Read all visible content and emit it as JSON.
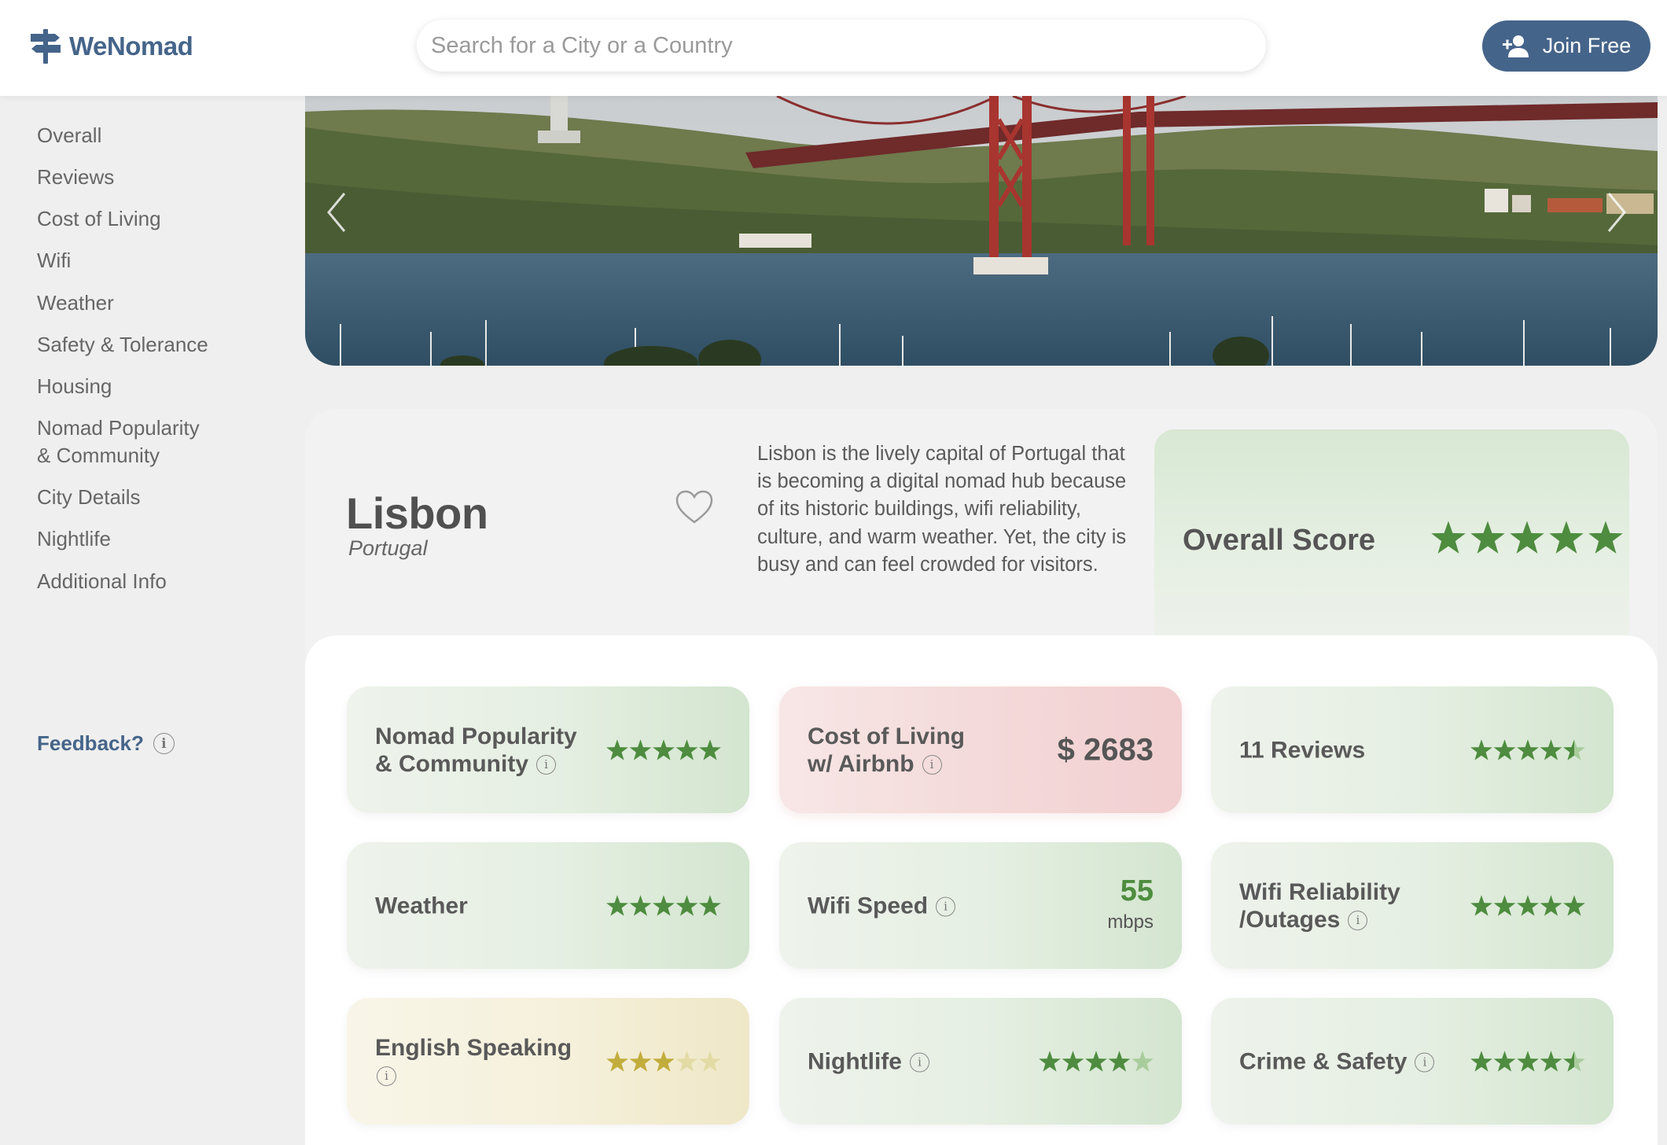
{
  "brand": {
    "name": "WeNomad",
    "color": "#45648a"
  },
  "header": {
    "search_placeholder": "Search for a City or a Country",
    "join_label": "Join Free"
  },
  "sidebar": {
    "items": [
      {
        "label": "Overall"
      },
      {
        "label": "Reviews"
      },
      {
        "label": "Cost of Living"
      },
      {
        "label": "Wifi"
      },
      {
        "label": "Weather"
      },
      {
        "label": "Safety & Tolerance"
      },
      {
        "label": "Housing"
      },
      {
        "label": "Nomad Popularity",
        "label2": "& Community"
      },
      {
        "label": "City Details"
      },
      {
        "label": "Nightlife"
      },
      {
        "label": "Additional Info"
      }
    ],
    "feedback_label": "Feedback?"
  },
  "city": {
    "name": "Lisbon",
    "country": "Portugal",
    "description": "Lisbon is the lively capital of Portugal that is becoming a digital nomad hub because of its historic buildings, wifi reliability, culture, and warm weather. Yet, the city is busy and can feel crowded for visitors."
  },
  "overall": {
    "label": "Overall Score",
    "rating": 5
  },
  "colors": {
    "star_green": "#4e8c3f",
    "star_green_light": "#a9cc9c",
    "star_yellow": "#c2ad3c",
    "star_yellow_light": "#e3dba5"
  },
  "tiles": [
    {
      "line1": "Nomad Popularity",
      "line2": "& Community",
      "rating": 5,
      "color": "green"
    },
    {
      "line1": "Cost of Living",
      "line2": "w/ Airbnb",
      "value": "$ 2683",
      "color": "red"
    },
    {
      "line1": "11 Reviews",
      "rating": 4.5,
      "color": "green"
    },
    {
      "line1": "Weather",
      "rating": 5,
      "color": "green"
    },
    {
      "line1": "Wifi Speed",
      "speed": "55",
      "unit": "mbps",
      "color": "green"
    },
    {
      "line1": "Wifi Reliability",
      "line2": "/Outages",
      "rating": 5,
      "color": "green"
    },
    {
      "line1": "English Speaking",
      "rating": 3,
      "color": "yellow"
    },
    {
      "line1": "Nightlife",
      "rating": 4,
      "color": "green"
    },
    {
      "line1": "Crime & Safety",
      "rating": 4.5,
      "color": "green"
    }
  ]
}
